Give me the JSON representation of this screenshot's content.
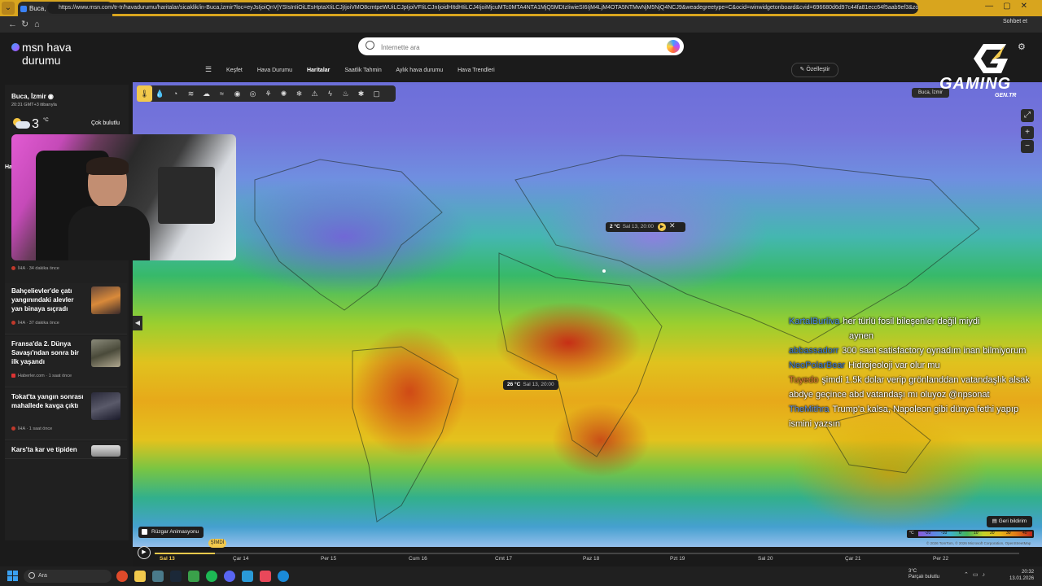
{
  "browser": {
    "tab_title": "Buca, İzmir Sıcaklık Haritası | MSN",
    "tab_close": "✕",
    "new_tab": "+",
    "url": "https://www.msn.com/tr-tr/havadurumu/haritalar/sicaklik/in-Buca,İzmir?loc=eyJsIjoiQnVjYSIsInIiOiLEsHptaXIiLCJjIjoiVMO8cmtpeWUiLCJpIjoiVFIiLCJnIjoidHItdHIiLCJ4IjoiMjcuMTc0MTA4NTA1MjQ5MDIzIiwieSI6IjM4LjM4OTA5NTMwNjM5NjQ4NCJ9&weadegreetype=C&ocid=winwidgetonboard&cvid=696680d6d97c44fa81ecc64f5aab9ef3&zo...",
    "copilot_label": "Sohbet et"
  },
  "header": {
    "logo_line1": "msn hava",
    "logo_line2": "durumu",
    "search_placeholder": "İnternette ara",
    "nav": [
      "Keşfet",
      "Hava Durumu",
      "Haritalar",
      "Saatlik Tahmin",
      "Aylık hava durumu",
      "Hava Trendleri"
    ],
    "personalize": "Özelleştir"
  },
  "sidebar": {
    "location": "Buca, İzmir",
    "time": "20:31 GMT+3 itibarıyla",
    "temp": "3",
    "unit": "°C",
    "condition": "Çok bulutlu",
    "partial_label": "Ha",
    "news": [
      {
        "title": "Bahçelievler'de çatı yangınındaki alevler yan binaya sıçradı",
        "source": "İHA · 37 dakika önce"
      },
      {
        "title": "Fransa'da 2. Dünya Savaşı'ndan sonra bir ilk yaşandı",
        "source": "Haberler.com · 1 saat önce"
      },
      {
        "title": "Tokat'ta yangın sonrası mahallede kavga çıktı",
        "source": "İHA · 1 saat önce"
      },
      {
        "title": "Kars'ta kar ve tipiden",
        "source": ""
      }
    ],
    "prev_news_source": "İHA · 34 dakika önce"
  },
  "map": {
    "location_chip": "Buca, İzmir",
    "tooltip1": {
      "temp": "2 °C",
      "time": "Sal 13, 20:00"
    },
    "tooltip2": {
      "temp": "26 °C",
      "time": "Sal 13, 20:00"
    },
    "wind_animation": "Rüzgar Animasyonu",
    "feedback": "Geri bildirim",
    "legend_labels": [
      "°C",
      "-20",
      "-10",
      "0",
      "10",
      "20",
      "30",
      "40"
    ],
    "credit": "© 2026 TomTom, © 2026 Microsoft Corporation, OpenStreetMap",
    "now_label": "ŞİMDİ",
    "days": [
      "Sal 13",
      "Çar 14",
      "Per 15",
      "Cum 16",
      "Cmt 17",
      "Paz 18",
      "Pzt 19",
      "Sal 20",
      "Çar 21",
      "Per 22"
    ],
    "progress_fraction": 0.07
  },
  "chat": [
    {
      "user": "KartalBurliva",
      "text": "her türlü fosil bileşenler değil miydi",
      "color": "#4d8be8"
    },
    {
      "user": "",
      "text": "aynen",
      "color": "#ffffff"
    },
    {
      "user": "abbassadorr",
      "text": "300 saat satisfactory oynadım inan bilmiyorum",
      "color": "#3a78d8"
    },
    {
      "user": "NeoPolarBear",
      "text": "Hidrojeoloji var olur mu",
      "color": "#3a78d8"
    },
    {
      "user": "Tuyedo",
      "text": "şimdi 1.5k dolar verip grönlanddan vatandaşlık alsak abdye geçince abd vatandaşı mı oluyoz @npsonat",
      "color": "#e07a3a"
    },
    {
      "user": "TheMithra",
      "text": "Trump'a kalsa, Napoleon gibi dünya fethi yapıp ismini yazsın",
      "color": "#5b8be0"
    }
  ],
  "overlay_logo": {
    "main": "GAMING",
    "sub": "GEN.TR"
  },
  "taskbar": {
    "search": "Ara",
    "weather_temp": "3°C",
    "weather_cond": "Parçalı bulutlu",
    "time": "20:32",
    "date": "13.01.2026"
  }
}
